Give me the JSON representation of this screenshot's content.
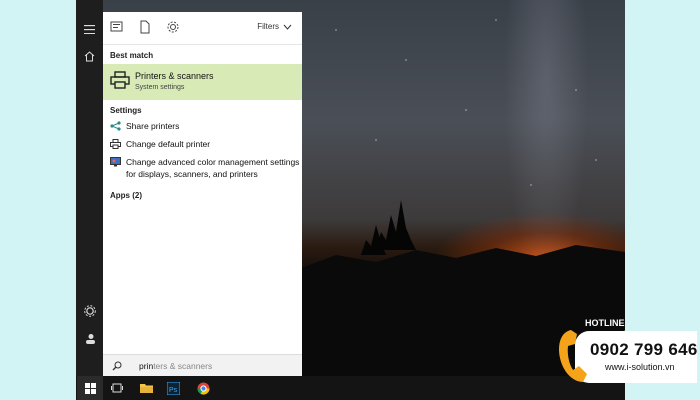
{
  "start_menu": {
    "filters_label": "Filters",
    "best_match": {
      "heading": "Best match",
      "item_title": "Printers & scanners",
      "item_subtitle": "System settings"
    },
    "settings_heading": "Settings",
    "settings_items": [
      {
        "label": "Share printers",
        "icon": "share-icon"
      },
      {
        "label": "Change default printer",
        "icon": "printer-icon"
      },
      {
        "label": "Change advanced color management settings for displays, scanners, and printers",
        "icon": "color-management-icon"
      }
    ],
    "apps_heading": "Apps (2)"
  },
  "search": {
    "typed_text": "prin",
    "suggestion_rest": "ters & scanners"
  },
  "hotline": {
    "label": "HOTLINE",
    "number": "0902 799 646",
    "website": "www.i-solution.vn"
  },
  "colors": {
    "best_match_highlight": "#d8eab5",
    "hotline_accent": "#f5a31a"
  }
}
